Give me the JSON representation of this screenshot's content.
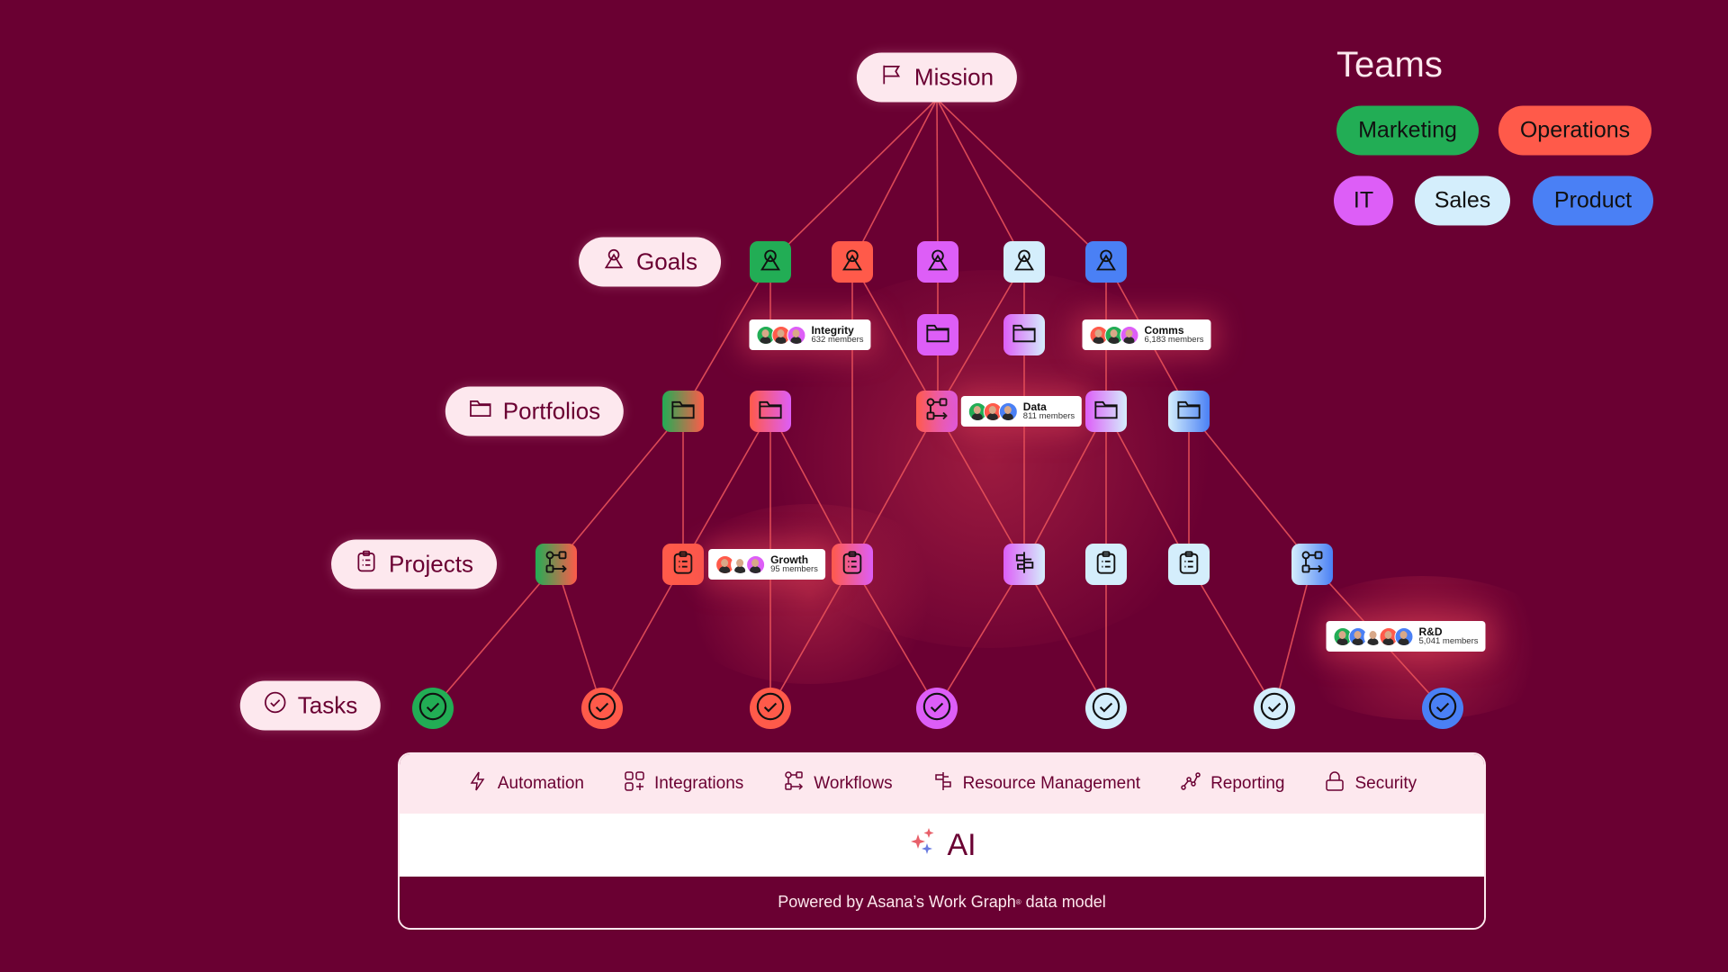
{
  "hierarchy": {
    "mission": {
      "label": "Mission",
      "icon": "flag-icon"
    },
    "levels": [
      {
        "id": "goals",
        "label": "Goals",
        "icon": "goal-icon"
      },
      {
        "id": "portfolios",
        "label": "Portfolios",
        "icon": "folder-icon"
      },
      {
        "id": "projects",
        "label": "Projects",
        "icon": "clipboard-icon"
      },
      {
        "id": "tasks",
        "label": "Tasks",
        "icon": "check-circle-icon"
      }
    ]
  },
  "teams": {
    "title": "Teams",
    "items": [
      {
        "label": "Marketing",
        "color": "#22ad55"
      },
      {
        "label": "Operations",
        "color": "#ff5a4a"
      },
      {
        "label": "IT",
        "color": "#dd5ef7"
      },
      {
        "label": "Sales",
        "color": "#d4eefc"
      },
      {
        "label": "Product",
        "color": "#4a80f5"
      }
    ]
  },
  "team_cards": [
    {
      "name": "Integrity",
      "members": "632 members",
      "avatar_colors": [
        "#22ad55",
        "#ff5a4a",
        "#dd5ef7"
      ]
    },
    {
      "name": "Comms",
      "members": "6,183 members",
      "avatar_colors": [
        "#ff5a4a",
        "#22ad55",
        "#dd5ef7"
      ]
    },
    {
      "name": "Data",
      "members": "811 members",
      "avatar_colors": [
        "#22ad55",
        "#ff5a4a",
        "#4a80f5"
      ]
    },
    {
      "name": "Growth",
      "members": "95 members",
      "avatar_colors": [
        "#ff5a4a",
        "#ffffff",
        "#dd5ef7"
      ]
    },
    {
      "name": "R&D",
      "members": "5,041 members",
      "avatar_colors": [
        "#22ad55",
        "#4a80f5",
        "#ffffff",
        "#ff5a4a",
        "#4a80f5"
      ]
    }
  ],
  "colors": {
    "background": "#6a0032",
    "pill": "#fde8ee",
    "edge": "#e8525a",
    "green": "#22ad55",
    "coral": "#ff5a4a",
    "purple": "#dd5ef7",
    "lightblue": "#d4eefc",
    "blue": "#4a80f5"
  },
  "features": [
    {
      "label": "Automation",
      "icon": "lightning-icon"
    },
    {
      "label": "Integrations",
      "icon": "integrations-icon"
    },
    {
      "label": "Workflows",
      "icon": "workflow-icon"
    },
    {
      "label": "Resource Management",
      "icon": "signpost-icon"
    },
    {
      "label": "Reporting",
      "icon": "line-chart-icon"
    },
    {
      "label": "Security",
      "icon": "lock-icon"
    }
  ],
  "ai": {
    "label": "AI",
    "icon": "sparkle-icon"
  },
  "footer": {
    "text_before": "Powered by Asana’s Work Graph",
    "mark": "®",
    "text_after": " data model"
  }
}
